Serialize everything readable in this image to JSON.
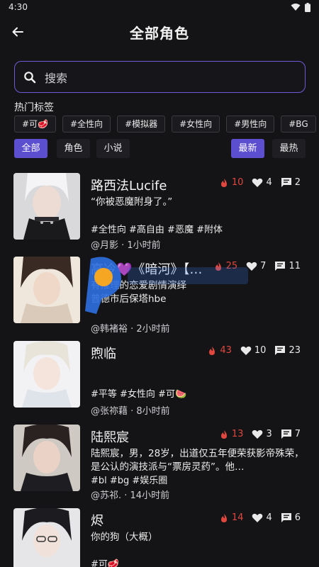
{
  "status_bar": {
    "time": "4:30"
  },
  "header": {
    "title": "全部角色"
  },
  "search": {
    "placeholder": "搜索"
  },
  "hot_tags": {
    "label": "热门标签",
    "items": [
      "#可🥩",
      "#全性向",
      "#模拟器",
      "#女性向",
      "#男性向",
      "#BG"
    ]
  },
  "filters": {
    "type": [
      "全部",
      "角色",
      "小说"
    ],
    "sort": [
      "最新",
      "最热"
    ],
    "active_type": "全部",
    "active_sort": "最新"
  },
  "characters": [
    {
      "name": "路西法Lucife",
      "fire": "10",
      "likes": "4",
      "comments": "2",
      "desc": "“你被恶魔附身了。”",
      "tags": "#全性向 #高自由 #恶魔 #附体",
      "meta": "@月影 · 1小时前"
    },
    {
      "name": "高冷💜《暗河》【…",
      "fire": "25",
      "likes": "7",
      "comments": "11",
      "desc": "有推理的恋爱剧情演绎\n普德市后保塔hbe",
      "tags": "",
      "meta": "@韩褚裕 · 2小时前"
    },
    {
      "name": "煦临",
      "fire": "43",
      "likes": "10",
      "comments": "23",
      "desc": "",
      "tags": "#平等 #女性向 #可🍉",
      "meta": "@张祢藉 · 8小时前"
    },
    {
      "name": "陆熙宸",
      "fire": "13",
      "likes": "3",
      "comments": "7",
      "desc": "陆熙宸，男，28岁，出道仅五年便荣获影帝殊荣，是公认的演技派与“票房灵药”。他…",
      "tags": "#bl #bg #娱乐圈",
      "meta": "@苏祁. · 14小时前"
    },
    {
      "name": "烬",
      "fire": "14",
      "likes": "4",
      "comments": "6",
      "desc": "你的狗（大概）",
      "tags": "#可🥩",
      "meta": ""
    }
  ],
  "colors": {
    "accent": "#5b4fd0",
    "fire": "#e0483f",
    "background": "#141416",
    "search_border": "#6b5cd6"
  }
}
